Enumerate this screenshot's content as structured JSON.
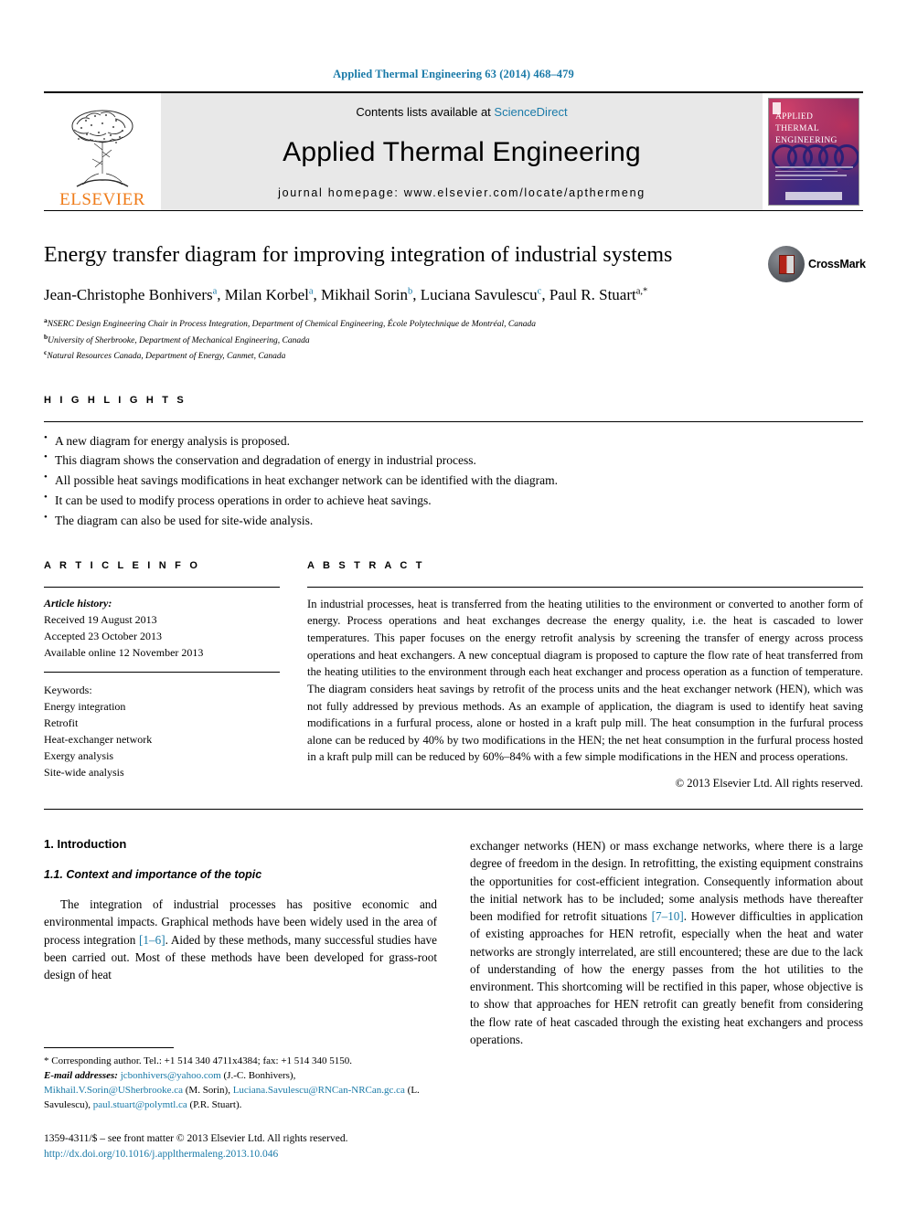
{
  "running_head": "Applied Thermal Engineering 63 (2014) 468–479",
  "masthead": {
    "contents_prefix": "Contents lists available at",
    "sciencedirect": "ScienceDirect",
    "journal_title": "Applied Thermal Engineering",
    "homepage": "journal homepage: www.elsevier.com/locate/apthermeng",
    "publisher_logo_label": "ELSEVIER",
    "cover": {
      "line1": "APPLIED",
      "line2": "THERMAL",
      "line3": "ENGINEERING"
    }
  },
  "article": {
    "title": "Energy transfer diagram for improving integration of industrial systems",
    "crossmark_label": "CrossMark",
    "authors": [
      {
        "name": "Jean-Christophe Bonhivers",
        "sup": "a",
        "sep": ", "
      },
      {
        "name": "Milan Korbel",
        "sup": "a",
        "sep": ", "
      },
      {
        "name": "Mikhail Sorin",
        "sup": "b",
        "sep": ", "
      },
      {
        "name": "Luciana Savulescu",
        "sup": "c",
        "sep": ", "
      },
      {
        "name": "Paul R. Stuart",
        "sup": "a,*",
        "sep": ""
      }
    ],
    "affiliations": [
      {
        "marker": "a",
        "text": "NSERC Design Engineering Chair in Process Integration, Department of Chemical Engineering, École Polytechnique de Montréal, Canada"
      },
      {
        "marker": "b",
        "text": "University of Sherbrooke, Department of Mechanical Engineering, Canada"
      },
      {
        "marker": "c",
        "text": "Natural Resources Canada, Department of Energy, Canmet, Canada"
      }
    ]
  },
  "highlights": {
    "heading": "H I G H L I G H T S",
    "items": [
      "A new diagram for energy analysis is proposed.",
      "This diagram shows the conservation and degradation of energy in industrial process.",
      "All possible heat savings modifications in heat exchanger network can be identified with the diagram.",
      "It can be used to modify process operations in order to achieve heat savings.",
      "The diagram can also be used for site-wide analysis."
    ]
  },
  "article_info": {
    "heading": "A R T I C L E   I N F O",
    "history_label": "Article history:",
    "history": [
      "Received 19 August 2013",
      "Accepted 23 October 2013",
      "Available online 12 November 2013"
    ],
    "keywords_label": "Keywords:",
    "keywords": [
      "Energy integration",
      "Retrofit",
      "Heat-exchanger network",
      "Exergy analysis",
      "Site-wide analysis"
    ]
  },
  "abstract": {
    "heading": "A B S T R A C T",
    "text": "In industrial processes, heat is transferred from the heating utilities to the environment or converted to another form of energy. Process operations and heat exchanges decrease the energy quality, i.e. the heat is cascaded to lower temperatures. This paper focuses on the energy retrofit analysis by screening the transfer of energy across process operations and heat exchangers. A new conceptual diagram is proposed to capture the flow rate of heat transferred from the heating utilities to the environment through each heat exchanger and process operation as a function of temperature. The diagram considers heat savings by retrofit of the process units and the heat exchanger network (HEN), which was not fully addressed by previous methods. As an example of application, the diagram is used to identify heat saving modifications in a furfural process, alone or hosted in a kraft pulp mill. The heat consumption in the furfural process alone can be reduced by 40% by two modifications in the HEN; the net heat consumption in the furfural process hosted in a kraft pulp mill can be reduced by 60%–84% with a few simple modifications in the HEN and process operations.",
    "copyright": "© 2013 Elsevier Ltd. All rights reserved."
  },
  "body": {
    "section_number_title": "1. Introduction",
    "subsection_title": "1.1. Context and importance of the topic",
    "left_paragraph_pre": "The integration of industrial processes has positive economic and environmental impacts. Graphical methods have been widely used in the area of process integration ",
    "left_citation": "[1–6]",
    "left_paragraph_post": ". Aided by these methods, many successful studies have been carried out. Most of these methods have been developed for grass-root design of heat",
    "right_paragraph_pre": "exchanger networks (HEN) or mass exchange networks, where there is a large degree of freedom in the design. In retrofitting, the existing equipment constrains the opportunities for cost-efficient integration. Consequently information about the initial network has to be included; some analysis methods have thereafter been modified for retrofit situations ",
    "right_citation": "[7–10]",
    "right_paragraph_post": ". However difficulties in application of existing approaches for HEN retrofit, especially when the heat and water networks are strongly interrelated, are still encountered; these are due to the lack of understanding of how the energy passes from the hot utilities to the environment. This shortcoming will be rectified in this paper, whose objective is to show that approaches for HEN retrofit can greatly benefit from considering the flow rate of heat cascaded through the existing heat exchangers and process operations."
  },
  "footnote": {
    "corresponding": "* Corresponding author. Tel.: +1 514 340 4711x4384; fax: +1 514 340 5150.",
    "email_label": "E-mail addresses:",
    "emails": [
      {
        "address": "jcbonhivers@yahoo.com",
        "person": " (J.-C. Bonhivers), "
      },
      {
        "address": "Mikhail.V.Sorin@USherbrooke.ca",
        "person": " (M. Sorin), "
      },
      {
        "address": "Luciana.Savulescu@RNCan-NRCan.gc.ca",
        "person": " (L. Savulescu), "
      },
      {
        "address": "paul.stuart@polymtl.ca",
        "person": " (P.R. Stuart)."
      }
    ]
  },
  "page_footer": {
    "issn_line": "1359-4311/$ – see front matter © 2013 Elsevier Ltd. All rights reserved.",
    "doi": "http://dx.doi.org/10.1016/j.applthermaleng.2013.10.046"
  }
}
